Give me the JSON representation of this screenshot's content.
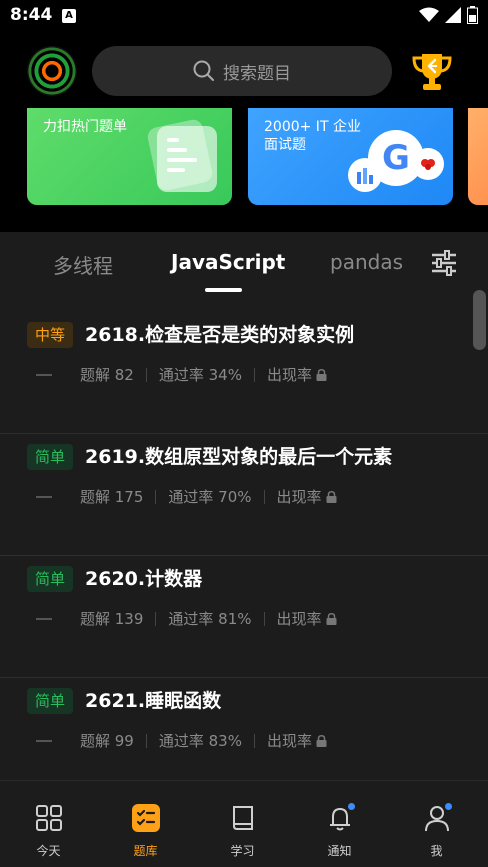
{
  "status": {
    "time": "8:44",
    "notif": "A"
  },
  "header": {
    "search_placeholder": "搜索题目"
  },
  "banners": [
    {
      "title": "力扣热门题单"
    },
    {
      "title_line1": "2000+ IT 企业",
      "title_line2": "面试题"
    }
  ],
  "tabs": [
    {
      "label": "多线程",
      "active": false
    },
    {
      "label": "JavaScript",
      "active": true
    },
    {
      "label": "pandas",
      "active": false
    }
  ],
  "problems": [
    {
      "difficulty": "中等",
      "level": "medium",
      "title": "2618.检查是否是类的对象实例",
      "solutions": "题解 82",
      "acceptance": "通过率 34%",
      "frequency": "出现率"
    },
    {
      "difficulty": "简单",
      "level": "easy",
      "title": "2619.数组原型对象的最后一个元素",
      "solutions": "题解 175",
      "acceptance": "通过率 70%",
      "frequency": "出现率"
    },
    {
      "difficulty": "简单",
      "level": "easy",
      "title": "2620.计数器",
      "solutions": "题解 139",
      "acceptance": "通过率 81%",
      "frequency": "出现率"
    },
    {
      "difficulty": "简单",
      "level": "easy",
      "title": "2621.睡眠函数",
      "solutions": "题解 99",
      "acceptance": "通过率 83%",
      "frequency": "出现率"
    }
  ],
  "nav": [
    {
      "label": "今天",
      "icon": "grid-icon",
      "active": false
    },
    {
      "label": "题库",
      "icon": "checklist-icon",
      "active": true
    },
    {
      "label": "学习",
      "icon": "book-icon",
      "active": false
    },
    {
      "label": "通知",
      "icon": "bell-icon",
      "active": false
    },
    {
      "label": "我",
      "icon": "person-icon",
      "active": false
    }
  ],
  "colors": {
    "accent": "#ffa116",
    "easy": "#2cbb5d",
    "medium": "#ffa116",
    "badge_dot": "#3b8eff"
  }
}
